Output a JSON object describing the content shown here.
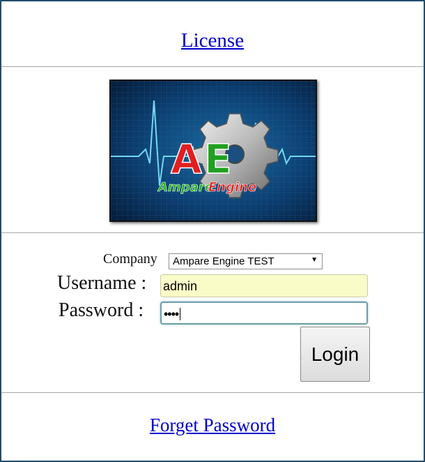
{
  "license_link": "License",
  "logo": {
    "letters": "AE",
    "name": "AmpareEngine",
    "colors": {
      "red": "#e02020",
      "green": "#20a020",
      "background": "#0a3a6a"
    }
  },
  "form": {
    "company_label": "Company",
    "company_selected": "Ampare Engine TEST",
    "username_label": "Username :",
    "username_value": "admin",
    "password_label": "Password :",
    "password_masked": "••••",
    "login_label": "Login"
  },
  "forget_password_link": "Forget Password"
}
